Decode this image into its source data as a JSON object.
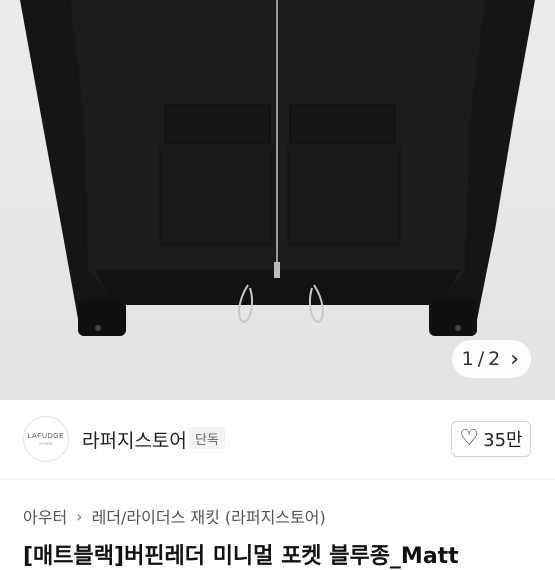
{
  "product_image": {
    "alt": "black jacket",
    "pager": {
      "current": "1",
      "separator": "/",
      "total": "2"
    }
  },
  "seller": {
    "logo_text": "LAFUDGE",
    "logo_subtext": "STORE",
    "name": "라퍼지스토어",
    "badge": "단독",
    "like_count": "35만"
  },
  "category": {
    "level1": "아우터",
    "level2": "레더/라이더스 재킷 (라퍼지스토어)"
  },
  "product_title": "[매트블랙]버핀레더 미니멀 포켓 블루종_Matt",
  "colors": {
    "accent": "#222222",
    "badge_bg": "#f2f2f2"
  }
}
